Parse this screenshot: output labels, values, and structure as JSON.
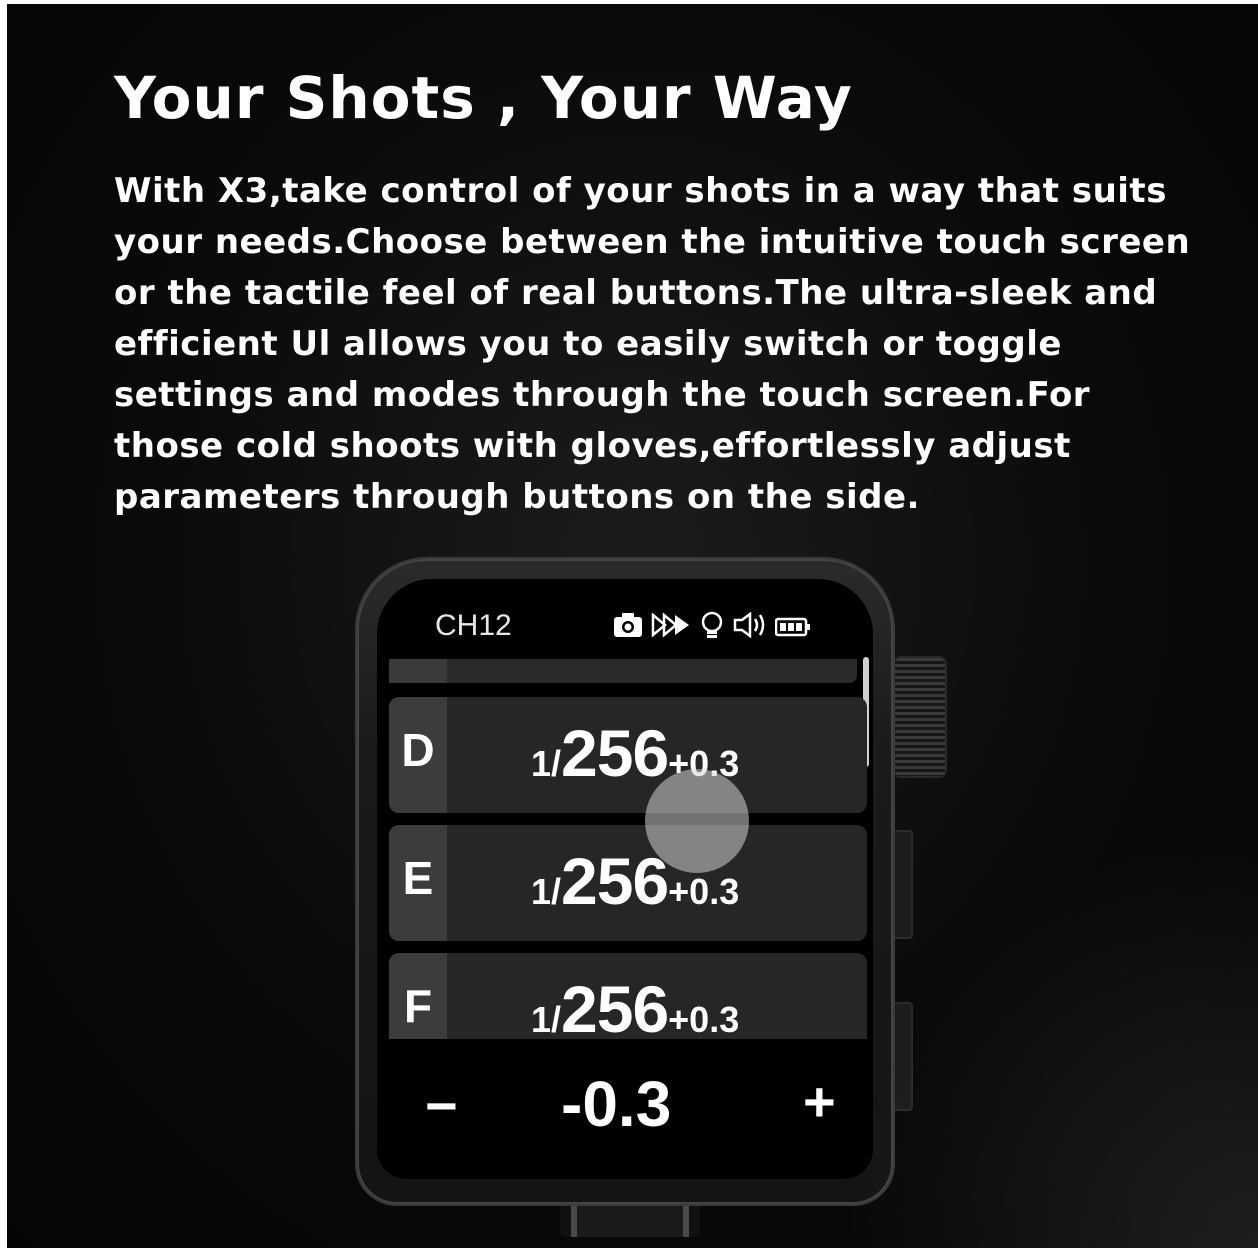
{
  "headline": "Your Shots , Your Way",
  "description": "With X3,take control of your shots in a way that suits your needs.Choose between the intuitive touch screen or the tactile feel of real buttons.The ultra-sleek and efficient Ul allows you to easily switch or toggle settings and modes through the touch screen.For those cold shoots with gloves,effortlessly adjust parameters through buttons on the side.",
  "device": {
    "channel": "CH12",
    "status_icons": [
      "camera-icon",
      "high-speed-sync-icon",
      "modeling-lamp-icon",
      "speaker-icon",
      "battery-icon"
    ],
    "groups": [
      {
        "letter": "D",
        "prefix": "1/",
        "power": "256",
        "ev": "+0.3"
      },
      {
        "letter": "E",
        "prefix": "1/",
        "power": "256",
        "ev": "+0.3"
      },
      {
        "letter": "F",
        "prefix": "1/",
        "power": "256",
        "ev": "+0.3"
      }
    ],
    "adjust": {
      "minus": "−",
      "value": "-0.3",
      "plus": "+"
    }
  }
}
